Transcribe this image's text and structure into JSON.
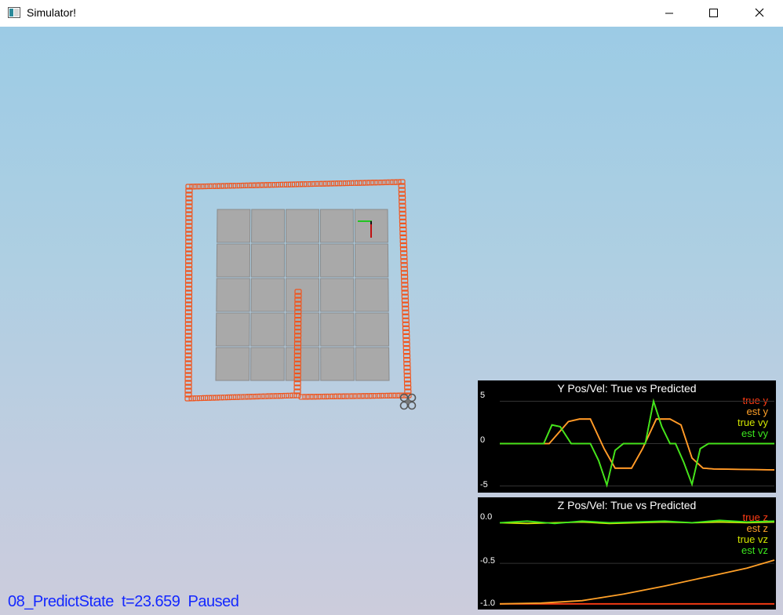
{
  "window": {
    "title": "Simulator!",
    "minimize_icon": "minimize-icon",
    "maximize_icon": "maximize-icon",
    "close_icon": "close-icon"
  },
  "status": {
    "scenario": "08_PredictState",
    "time": "t=23.659",
    "state": "Paused"
  },
  "colors": {
    "trail": "#f0551e",
    "tile": "#a9a9a9",
    "status_text": "#1428ff",
    "true_pos": "#ff3c14",
    "est_pos": "#ffa028",
    "true_vel": "#d2e600",
    "est_vel": "#3ce61e"
  },
  "plots": {
    "y": {
      "title": "Y Pos/Vel: True vs Predicted",
      "yticks": [
        "5",
        "0",
        "-5"
      ],
      "legend": [
        "true y",
        "est y",
        "true vy",
        "est vy"
      ]
    },
    "z": {
      "title": "Z Pos/Vel: True vs Predicted",
      "yticks": [
        "0.0",
        "-0.5",
        "-1.0"
      ],
      "legend": [
        "true z",
        "est z",
        "true vz",
        "est vz"
      ]
    }
  },
  "chart_data": [
    {
      "type": "line",
      "title": "Y Pos/Vel: True vs Predicted",
      "ylim": [
        -5.6,
        5.6
      ],
      "xlim": [
        0,
        1
      ],
      "series": [
        {
          "name": "true y",
          "x": [
            0,
            0.18,
            0.25,
            0.29,
            0.33,
            0.38,
            0.42,
            0.48,
            0.52,
            0.57,
            0.62,
            0.66,
            0.7,
            0.74,
            0.78,
            1
          ],
          "y": [
            0,
            0,
            2.6,
            2.9,
            2.9,
            -0.6,
            -2.9,
            -2.9,
            -0.6,
            2.9,
            2.9,
            2.2,
            -1.7,
            -2.9,
            -3.0,
            -3.1
          ]
        },
        {
          "name": "est y",
          "x": [
            0,
            0.18,
            0.25,
            0.29,
            0.33,
            0.38,
            0.42,
            0.48,
            0.52,
            0.57,
            0.62,
            0.66,
            0.7,
            0.74,
            0.78,
            1
          ],
          "y": [
            0,
            0,
            2.6,
            2.9,
            2.9,
            -0.6,
            -2.9,
            -2.9,
            -0.6,
            2.9,
            2.9,
            2.2,
            -1.7,
            -2.9,
            -3.0,
            -3.1
          ]
        },
        {
          "name": "true vy",
          "x": [
            0,
            0.16,
            0.19,
            0.22,
            0.26,
            0.3,
            0.33,
            0.36,
            0.39,
            0.42,
            0.45,
            0.5,
            0.53,
            0.56,
            0.59,
            0.62,
            0.64,
            0.67,
            0.7,
            0.73,
            0.76,
            0.8,
            1
          ],
          "y": [
            0,
            0,
            2.2,
            2.0,
            0,
            0,
            0,
            -2.0,
            -4.9,
            -0.8,
            0,
            0,
            0,
            5.0,
            2.0,
            0,
            0,
            -2.2,
            -4.8,
            -0.6,
            0,
            0,
            0
          ]
        },
        {
          "name": "est vy",
          "x": [
            0,
            0.16,
            0.19,
            0.22,
            0.26,
            0.3,
            0.33,
            0.36,
            0.39,
            0.42,
            0.45,
            0.5,
            0.53,
            0.56,
            0.59,
            0.62,
            0.64,
            0.67,
            0.7,
            0.73,
            0.76,
            0.8,
            1
          ],
          "y": [
            0,
            0,
            2.2,
            2.0,
            0,
            0,
            0,
            -2.0,
            -4.9,
            -0.8,
            0,
            0,
            0,
            5.0,
            2.0,
            0,
            0,
            -2.2,
            -4.8,
            -0.6,
            0,
            0,
            0
          ]
        }
      ]
    },
    {
      "type": "line",
      "title": "Z Pos/Vel: True vs Predicted",
      "ylim": [
        -1.05,
        0.12
      ],
      "xlim": [
        0,
        1
      ],
      "series": [
        {
          "name": "true z",
          "x": [
            0,
            0.2,
            0.5,
            1
          ],
          "y": [
            -1.0,
            -1.0,
            -1.0,
            -1.0
          ]
        },
        {
          "name": "est z",
          "x": [
            0,
            0.15,
            0.3,
            0.45,
            0.6,
            0.75,
            0.9,
            1
          ],
          "y": [
            -1.0,
            -0.99,
            -0.96,
            -0.88,
            -0.78,
            -0.67,
            -0.56,
            -0.46
          ]
        },
        {
          "name": "true vz",
          "x": [
            0,
            0.1,
            0.2,
            0.3,
            0.4,
            0.5,
            0.6,
            0.7,
            0.8,
            0.9,
            1
          ],
          "y": [
            0.0,
            -0.01,
            0.0,
            0.01,
            -0.01,
            0.0,
            0.01,
            0.0,
            0.01,
            0.0,
            0.01
          ]
        },
        {
          "name": "est vz",
          "x": [
            0,
            0.1,
            0.2,
            0.3,
            0.4,
            0.5,
            0.6,
            0.7,
            0.8,
            0.9,
            1
          ],
          "y": [
            0.0,
            0.02,
            -0.01,
            0.02,
            0.0,
            0.01,
            0.02,
            0.0,
            0.03,
            0.01,
            0.02
          ]
        }
      ]
    }
  ]
}
